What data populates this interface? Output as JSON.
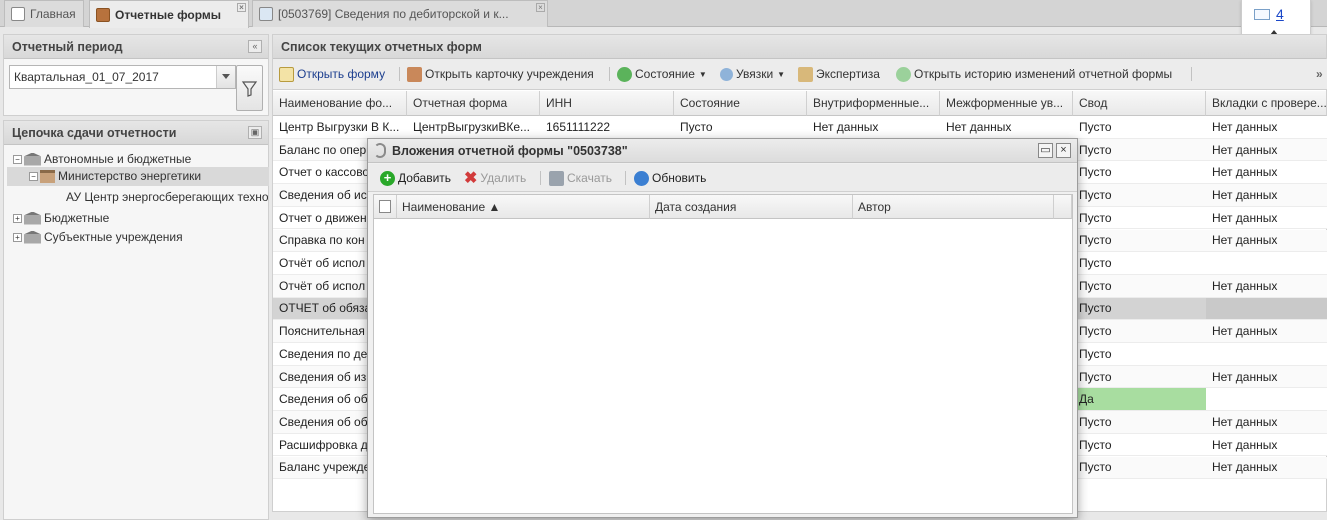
{
  "tabs": [
    {
      "label": "Главная",
      "active": false
    },
    {
      "label": "Отчетные формы",
      "active": true
    },
    {
      "label": "[0503769] Сведения по дебиторской и к...",
      "active": false
    }
  ],
  "mail": {
    "count": "4"
  },
  "left": {
    "period_title": "Отчетный период",
    "period_value": "Квартальная_01_07_2017",
    "chain_title": "Цепочка сдачи отчетности",
    "tree": [
      {
        "label": "Автономные и бюджетные",
        "level": 0,
        "expander": "−"
      },
      {
        "label": "Министерство энергетики",
        "level": 1,
        "expander": "−"
      },
      {
        "label": "АУ Центр энергосберегающих технологий",
        "level": 2,
        "expander": ""
      },
      {
        "label": "Бюджетные",
        "level": 0,
        "expander": "+"
      },
      {
        "label": "Субъектные учреждения",
        "level": 0,
        "expander": "+"
      }
    ]
  },
  "main": {
    "title": "Список текущих отчетных форм",
    "toolbar": {
      "open_form": "Открыть форму",
      "open_card": "Открыть карточку учреждения",
      "state": "Состояние",
      "links": "Увязки",
      "expertise": "Экспертиза",
      "history": "Открыть историю изменений отчетной формы"
    },
    "columns": [
      "Наименование фо...",
      "Отчетная форма",
      "ИНН",
      "Состояние",
      "Внутриформенные...",
      "Межформенные ув...",
      "Свод",
      "Вкладки с провере..."
    ],
    "rows": [
      {
        "name": "Центр Выгрузки В К...",
        "form": "ЦентрВыгрузкиВКе...",
        "inn": "1651111222",
        "state": "Пусто",
        "intra": "Нет данных",
        "inter": "Нет данных",
        "svod": "Пусто",
        "tabs": "Нет данных"
      },
      {
        "name": "Баланс по опер",
        "svod": "Пусто",
        "tabs": "Нет данных"
      },
      {
        "name": "Отчет о кассово",
        "svod": "Пусто",
        "tabs": "Нет данных"
      },
      {
        "name": "Сведения об ис",
        "svod": "Пусто",
        "tabs": "Нет данных"
      },
      {
        "name": "Отчет о движен",
        "svod": "Пусто",
        "tabs": "Нет данных"
      },
      {
        "name": "Справка по кон",
        "svod": "Пусто",
        "tabs": "Нет данных"
      },
      {
        "name": "Отчёт об испол",
        "svod": "Пусто",
        "tabs": ""
      },
      {
        "name": "Отчёт об испол",
        "svod": "Пусто",
        "tabs": "Нет данных"
      },
      {
        "name": "ОТЧЕТ об обяза",
        "svod": "Пусто",
        "tabs": "",
        "selected": true
      },
      {
        "name": "Пояснительная",
        "svod": "Пусто",
        "tabs": "Нет данных"
      },
      {
        "name": "Сведения по де",
        "svod": "Пусто",
        "tabs": ""
      },
      {
        "name": "Сведения об из",
        "svod": "Пусто",
        "tabs": "Нет данных"
      },
      {
        "name": "Сведения об об",
        "svod": "Да",
        "tabs": "",
        "highlight": true
      },
      {
        "name": "Сведения об об",
        "svod": "Пусто",
        "tabs": "Нет данных"
      },
      {
        "name": "Расшифровка д",
        "svod": "Пусто",
        "tabs": "Нет данных"
      },
      {
        "name": "Баланс учрежде",
        "svod": "Пусто",
        "tabs": "Нет данных"
      }
    ]
  },
  "modal": {
    "title": "Вложения отчетной формы \"0503738\"",
    "toolbar": {
      "add": "Добавить",
      "delete": "Удалить",
      "download": "Скачать",
      "refresh": "Обновить"
    },
    "columns": [
      "Наименование ▲",
      "Дата создания",
      "Автор"
    ]
  },
  "colors": {
    "highlight": "#a8dda0",
    "selected": "#d3d3d3",
    "add_icon": "#2aa82a",
    "delete_icon": "#d23b3b",
    "refresh_icon": "#3b7fd2"
  }
}
